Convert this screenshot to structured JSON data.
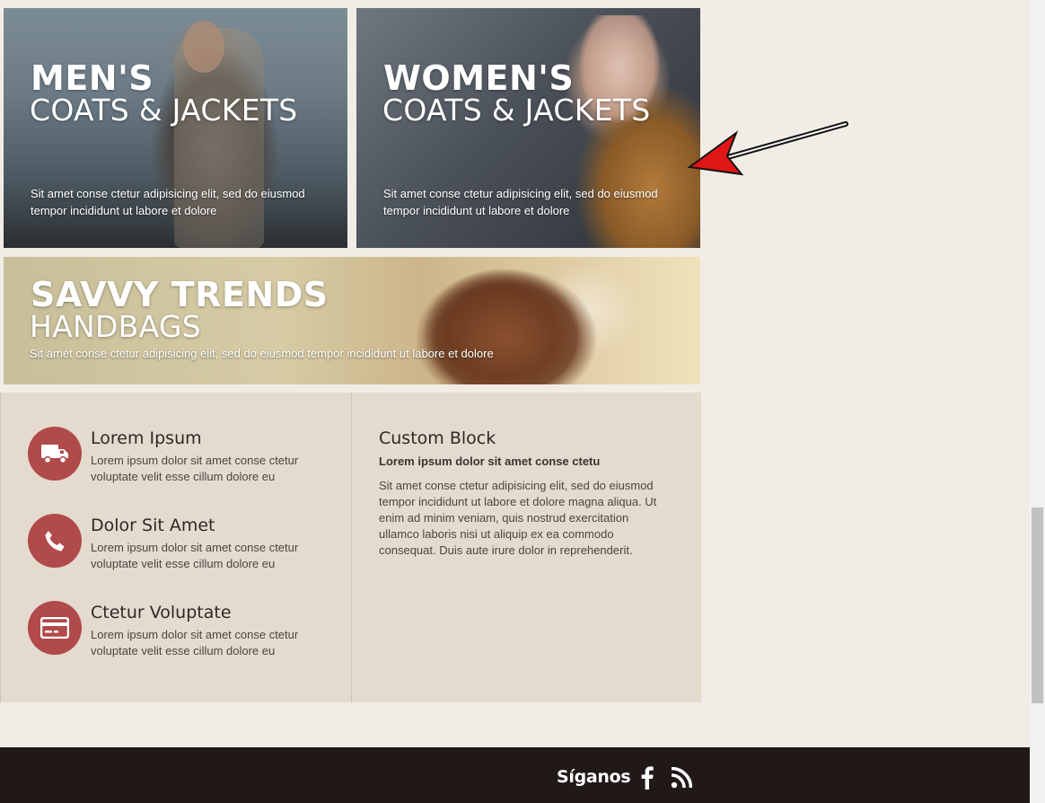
{
  "banners": [
    {
      "title": "MEN'S",
      "subtitle": "COATS & JACKETS",
      "text": "Sit amet conse ctetur adipisicing elit, sed do eiusmod tempor incididunt ut labore et dolore"
    },
    {
      "title": "WOMEN'S",
      "subtitle": "COATS & JACKETS",
      "text": "Sit amet conse ctetur adipisicing elit, sed do eiusmod tempor incididunt ut labore et dolore"
    },
    {
      "title": "SAVVY TRENDS",
      "subtitle": "HANDBAGS",
      "text": "Sit amet conse ctetur adipisicing elit, sed do eiusmod tempor incididunt ut labore et dolore"
    }
  ],
  "features": [
    {
      "icon": "truck-icon",
      "title": "Lorem Ipsum",
      "text": "Lorem ipsum dolor sit amet conse ctetur voluptate velit esse cillum dolore eu"
    },
    {
      "icon": "phone-icon",
      "title": "Dolor Sit Amet",
      "text": "Lorem ipsum dolor sit amet conse ctetur voluptate velit esse cillum dolore eu"
    },
    {
      "icon": "credit-card-icon",
      "title": "Ctetur Voluptate",
      "text": "Lorem ipsum dolor sit amet conse ctetur voluptate velit esse cillum dolore eu"
    }
  ],
  "custom_block": {
    "title": "Custom Block",
    "lead": "Lorem ipsum dolor sit amet conse ctetu",
    "body": "Sit amet conse ctetur adipisicing elit, sed do eiusmod tempor incididunt ut labore et dolore magna aliqua. Ut enim ad minim veniam, quis nostrud exercitation ullamco laboris nisi ut aliquip ex ea commodo consequat. Duis aute irure dolor in reprehenderit."
  },
  "footer": {
    "follow_label": "Síganos",
    "social": [
      "facebook-icon",
      "rss-icon"
    ]
  },
  "colors": {
    "accent": "#b14a4a",
    "panel": "#e4dace",
    "footer": "#211918",
    "page": "#f1ece6"
  }
}
